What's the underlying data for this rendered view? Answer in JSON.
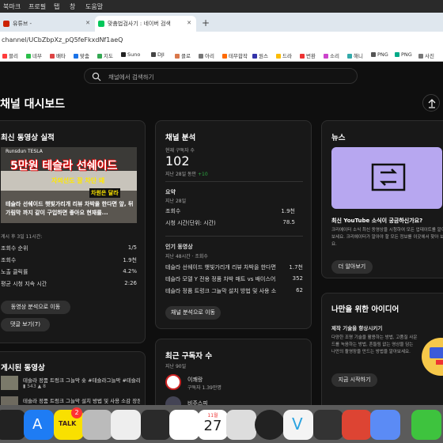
{
  "menubar": {
    "items": [
      "북마크",
      "프로필",
      "탭",
      "창",
      "도움말"
    ]
  },
  "tabs": [
    {
      "label": "유튜브 - ",
      "active": false,
      "color": "#cc2200"
    },
    {
      "label": "맞춤법검사기 : 네이버 검색",
      "active": true,
      "color": "#03c75a"
    },
    {
      "label": "",
      "active": false,
      "color": "#333"
    }
  ],
  "address": {
    "url": "channel/UCbZbpXz_pQ5feFkxdNf1aeQ"
  },
  "bookmarks": [
    {
      "label": "블리",
      "color": "#ff3b3b"
    },
    {
      "label": "네부",
      "color": "#2bbf4a"
    },
    {
      "label": "배타",
      "color": "#d44"
    },
    {
      "label": "맞춤",
      "color": "#1a73e8"
    },
    {
      "label": "지도",
      "color": "#34a853"
    },
    {
      "label": "Suno",
      "color": "#222"
    },
    {
      "label": "DJI",
      "color": "#444"
    },
    {
      "label": "클로",
      "color": "#d9774a"
    },
    {
      "label": "아리",
      "color": "#777"
    },
    {
      "label": "테무합작",
      "color": "#ff6a00"
    },
    {
      "label": "원스",
      "color": "#33a"
    },
    {
      "label": "드라",
      "color": "#fbbc05"
    },
    {
      "label": "번환",
      "color": "#e33"
    },
    {
      "label": "소리",
      "color": "#c4c"
    },
    {
      "label": "해니",
      "color": "#3aa"
    },
    {
      "label": "PNG",
      "color": "#555"
    },
    {
      "label": "PNG",
      "color": "#0a8"
    },
    {
      "label": "사진",
      "color": "#777"
    }
  ],
  "search": {
    "placeholder": "채널에서 검색하기"
  },
  "page": {
    "title": "채널 대시보드"
  },
  "latest": {
    "title": "최신 동영상 실적",
    "thumb_title": "5만원 테슬라 선쉐이드",
    "thumb_sub": "자외선도 잘 차단 돼",
    "thumb_sub2": "차원은 달라",
    "thumb_brand": "Runsdun TESLA",
    "video_title": "테슬라 선쉐이드 햇빛가리개 리뷰 차박을 한다면 앞, 뒤 가림막 까지 같이 구입하면 좋아요 현재를...",
    "since": "게시 후 3일 11시간:",
    "rows": [
      {
        "label": "조회수 순위",
        "value": "1/5"
      },
      {
        "label": "조회수",
        "value": "1.9천"
      },
      {
        "label": "노출 클릭률",
        "value": "4.2%"
      },
      {
        "label": "평균 시청 지속 시간",
        "value": "2:26"
      }
    ],
    "btn1": "동영상 분석으로 이동",
    "btn2": "댓글 보기(7)"
  },
  "analytics": {
    "title": "채널 분석",
    "subs_label": "현재 구독자 수",
    "subs": "102",
    "subs_note": "지난 28일 동안",
    "subs_delta": "+10",
    "summary": "요약",
    "summary_period": "지난 28일",
    "rows": [
      {
        "label": "조회수",
        "value": "1.9천"
      },
      {
        "label": "시청 시간(단위: 시간)",
        "value": "78.5"
      }
    ],
    "popular": "인기 동영상",
    "popular_period": "지난 48시간 · 조회수",
    "videos": [
      {
        "title": "테슬라 선쉐이드 햇빛가리개 리뷰 차박을 한다면 앞, 뒤 가...",
        "value": "1.7천"
      },
      {
        "title": "테슬라 모델 Y 전용 정품 차박 매트 vs 배이스어스 모델 Y...",
        "value": "352"
      },
      {
        "title": "테슬라 정품 트렁크 그늘막 설치 방법 및 사용 소감 장점과 ...",
        "value": "62"
      }
    ],
    "btn": "채널 분석으로 이동"
  },
  "news": {
    "title": "뉴스",
    "headline": "최신 YouTube 소식이 궁금하신가요?",
    "body": "크리에이터 소식 최신 동영상을 시청하여 모든 업데이트를 알아보세요. 크리에이터가 알아야 할 모든 정보를 이곳에서 찾아 보세요.",
    "btn": "더 알아보기"
  },
  "ideas": {
    "title": "나만을 위한 아이디어",
    "subtitle": "제작 기술을 향상시키기",
    "body": "다양한 조명 기술을 활용하는 방법, 고품질 사운드를 녹음하는 방법, 흔들림 없는 영상을 담는 나만의 촬영장을 만드는 방법을 알아보세요.",
    "btn": "지금 시작하기"
  },
  "posted": {
    "title": "게시된 동영상",
    "items": [
      {
        "title": "테슬라 정품 트렁크 그늘막 숏 #테슬라그늘막 #테슬라...",
        "views": "543",
        "likes": "8"
      },
      {
        "title": "테슬라 정품 트렁크 그늘막 설치 방법 및 사용 소감 장점...",
        "views": "",
        "likes": ""
      }
    ]
  },
  "recent_subs": {
    "title": "최근 구독자 수",
    "period": "지난 90일",
    "items": [
      {
        "name": "이쾌랑",
        "sub": "구독자 1.39만명"
      },
      {
        "name": "비주스피",
        "sub": ""
      }
    ]
  },
  "dock": {
    "calendar_month": "11월",
    "calendar_day": "27",
    "talk_label": "TALK",
    "badge": "2"
  }
}
